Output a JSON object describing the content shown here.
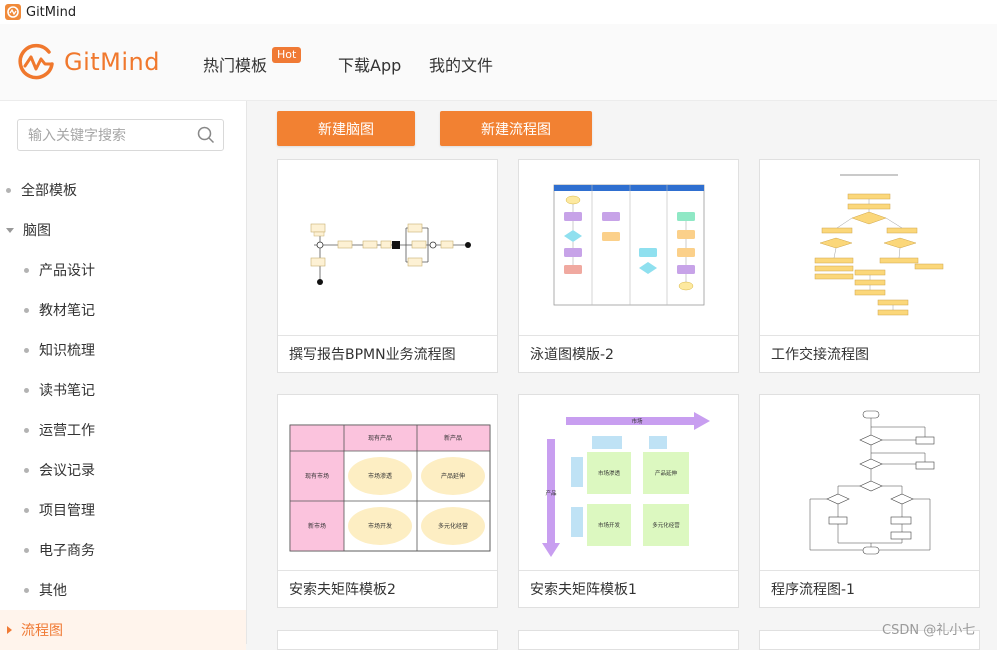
{
  "window": {
    "title": "GitMind"
  },
  "header": {
    "logo_text": "GitMind",
    "nav": [
      {
        "label": "热门模板"
      },
      {
        "label": "下载App"
      },
      {
        "label": "我的文件"
      }
    ],
    "hot_badge": "Hot"
  },
  "sidebar": {
    "search_placeholder": "输入关键字搜索",
    "items": [
      {
        "label": "全部模板"
      },
      {
        "label": "脑图"
      },
      {
        "label": "产品设计"
      },
      {
        "label": "教材笔记"
      },
      {
        "label": "知识梳理"
      },
      {
        "label": "读书笔记"
      },
      {
        "label": "运营工作"
      },
      {
        "label": "会议记录"
      },
      {
        "label": "项目管理"
      },
      {
        "label": "电子商务"
      },
      {
        "label": "其他"
      },
      {
        "label": "流程图"
      }
    ]
  },
  "actions": {
    "new_mindmap": "新建脑图",
    "new_flowchart": "新建流程图"
  },
  "cards": [
    {
      "title": "撰写报告BPMN业务流程图"
    },
    {
      "title": "泳道图模版-2"
    },
    {
      "title": "工作交接流程图"
    },
    {
      "title": "安索夫矩阵模板2"
    },
    {
      "title": "安索夫矩阵模板1"
    },
    {
      "title": "程序流程图-1"
    }
  ],
  "thumb_text": {
    "ansoff2": {
      "existing_product": "现有产品",
      "new_product": "新产品",
      "existing_market": "现有市场",
      "new_market": "新市场",
      "q1": "市场渗透",
      "q2": "产品延伸",
      "q3": "市场开发",
      "q4": "多元化经营"
    },
    "ansoff1": {
      "top_arrow": "市场",
      "side_arrow": "产品",
      "q1": "市场渗透",
      "q2": "产品延伸",
      "q3": "市场开发",
      "q4": "多元化经营"
    }
  },
  "watermark": "CSDN @礼小七",
  "colors": {
    "accent": "#f28132",
    "brand": "#f0782d"
  }
}
